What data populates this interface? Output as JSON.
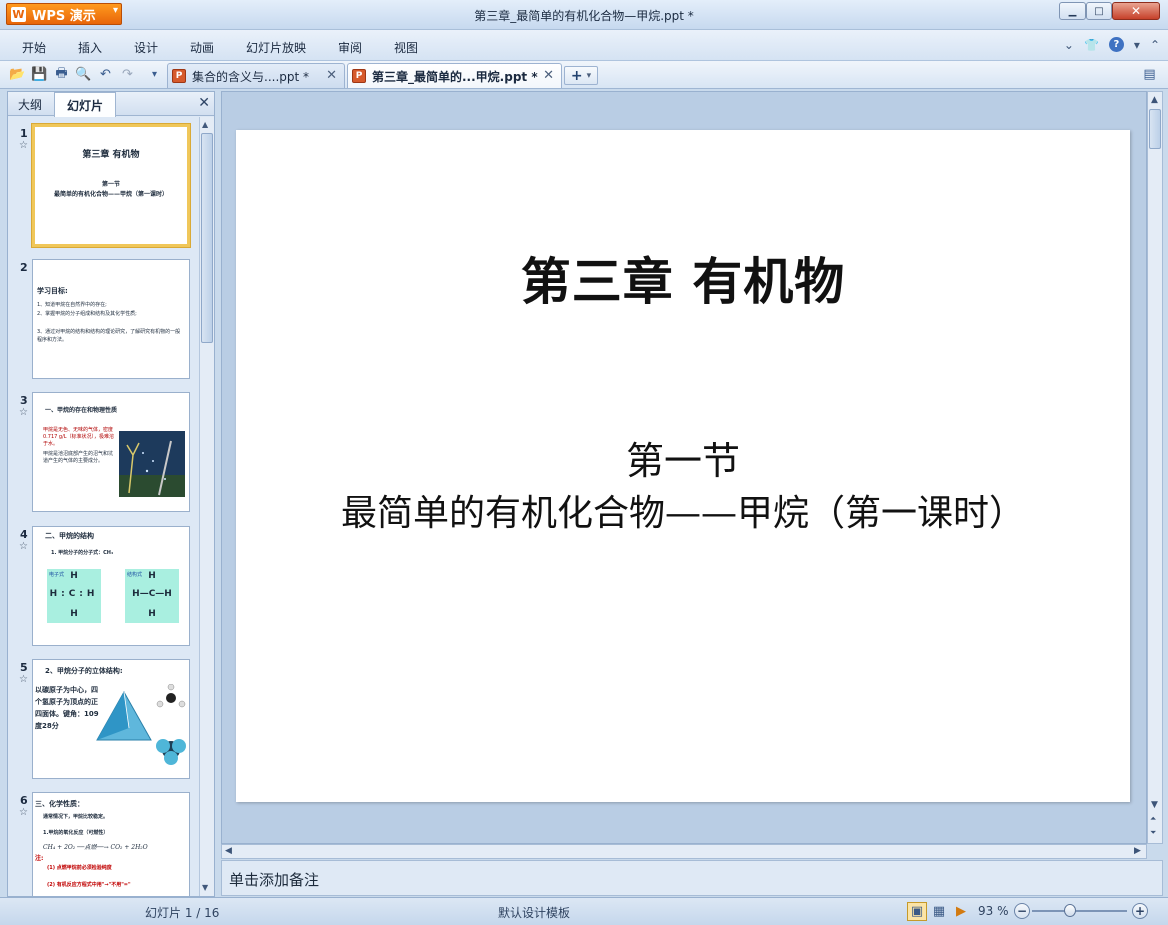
{
  "app": {
    "logo_text": "WPS 演示",
    "window_title": "第三章_最简单的有机化合物—甲烷.ppt *"
  },
  "menu": {
    "items": [
      "开始",
      "插入",
      "设计",
      "动画",
      "幻灯片放映",
      "审阅",
      "视图"
    ]
  },
  "tabs": [
    {
      "label": "集合的含义与....ppt *",
      "active": false
    },
    {
      "label": "第三章_最简单的...甲烷.ppt *",
      "active": true
    }
  ],
  "left_pane": {
    "tab_outline": "大纲",
    "tab_slides": "幻灯片",
    "thumbnails": [
      {
        "number": "1",
        "title": "第三章 有机物",
        "lines": [
          "第一节",
          "最简单的有机化合物——甲烷（第一课时）"
        ]
      },
      {
        "number": "2",
        "title": "学习目标:",
        "lines": [
          "1、知道甲烷在自然界中的存在;",
          "2、掌握甲烷的分子组成和结构及其化学性质;",
          "3、通过对甲烷的结构和结构的理论研究，了解研究有机物的一般程序和方法。"
        ]
      },
      {
        "number": "3",
        "title": "一、甲烷的存在和物理性质",
        "lines": [
          "甲烷是无色、无味的气体，密度0.717 g/L（标准状况），极难溶于水。",
          "甲烷是池沼底部产生的沼气和坑道产生的气体的主要成分。"
        ]
      },
      {
        "number": "4",
        "title": "二、甲烷的结构",
        "lines": [
          "1. 甲烷分子的分子式：CH₄",
          "电子式",
          "结构式"
        ]
      },
      {
        "number": "5",
        "title": "2、甲烷分子的立体结构:",
        "lines": [
          "以碳原子为中心，四个氢原子为顶点的正四面体。键角：109度28分"
        ]
      },
      {
        "number": "6",
        "title": "三、化学性质：",
        "lines": [
          "通常情况下，甲烷比较稳定。",
          "1.甲烷的氧化反应（可燃性）",
          "CH₄ + 2O₂ ──点燃──→ CO₂ + 2H₂O",
          "注:",
          "(1) 点燃甲烷前必须检验纯度",
          "(2) 有机反应方程式中用\"→\"不用\"=\""
        ]
      }
    ]
  },
  "slide": {
    "title": "第三章 有机物",
    "subtitle_line1": "第一节",
    "subtitle_line2": "最简单的有机化合物——甲烷（第一课时）"
  },
  "notes": {
    "placeholder": "单击添加备注"
  },
  "status": {
    "page_indicator": "幻灯片 1 / 16",
    "template_name": "默认设计模板",
    "zoom": "93 %",
    "zoom_fraction": 0.4
  },
  "colors": {
    "accent_orange": "#e8650a",
    "selected_thumb_border": "#f0c75a",
    "chrome_blue": "#c9daec"
  }
}
